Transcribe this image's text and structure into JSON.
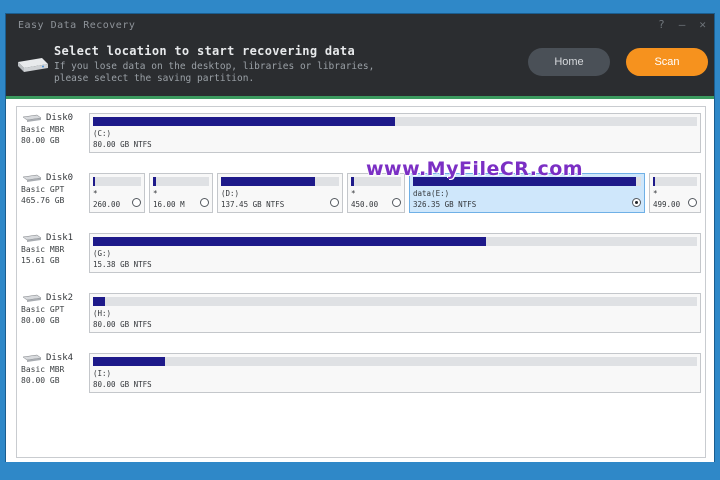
{
  "window": {
    "title": "Easy Data Recovery",
    "controls": [
      "?",
      "–",
      "✕"
    ]
  },
  "header": {
    "title": "Select location to start recovering data",
    "subtitle_line1": "If you lose data on the desktop, libraries or libraries,",
    "subtitle_line2": "please select the saving partition.",
    "home_button": "Home",
    "scan_button": "Scan",
    "icon": "hard-drive-icon"
  },
  "colors": {
    "accent_green": "#3c9a5f",
    "scan_orange": "#f6921e",
    "bar_fill": "#1e1a8a",
    "selected_bg": "#cfe7fb",
    "watermark": "#7b2fc4"
  },
  "watermark": "www.MyFileCR.com",
  "disks": [
    {
      "name": "Disk0",
      "type": "Basic MBR",
      "size": "80.00 GB",
      "partitions": [
        {
          "label": "(C:)",
          "size": "80.00 GB NTFS",
          "fill": 0.5,
          "radio": false,
          "selected": false
        }
      ]
    },
    {
      "name": "Disk0",
      "type": "Basic GPT",
      "size": "465.76 GB",
      "partitions": [
        {
          "label": "*",
          "size": "260.00",
          "fill": 0.05,
          "radio": true,
          "selected": false
        },
        {
          "label": "*",
          "size": "16.00 M",
          "fill": 0.05,
          "radio": true,
          "selected": false
        },
        {
          "label": "(D:)",
          "size": "137.45 GB NTFS",
          "fill": 0.8,
          "radio": true,
          "selected": false
        },
        {
          "label": "*",
          "size": "450.00",
          "fill": 0.05,
          "radio": true,
          "selected": false
        },
        {
          "label": "data(E:)",
          "size": "326.35 GB NTFS",
          "fill": 0.98,
          "radio": true,
          "selected": true
        },
        {
          "label": "*",
          "size": "499.00",
          "fill": 0.05,
          "radio": true,
          "selected": false
        }
      ]
    },
    {
      "name": "Disk1",
      "type": "Basic MBR",
      "size": "15.61 GB",
      "partitions": [
        {
          "label": "(G:)",
          "size": "15.38 GB NTFS",
          "fill": 0.65,
          "radio": false,
          "selected": false
        }
      ]
    },
    {
      "name": "Disk2",
      "type": "Basic GPT",
      "size": "80.00 GB",
      "partitions": [
        {
          "label": "(H:)",
          "size": "80.00 GB NTFS",
          "fill": 0.02,
          "radio": false,
          "selected": false
        }
      ]
    },
    {
      "name": "Disk4",
      "type": "Basic MBR",
      "size": "80.00 GB",
      "partitions": [
        {
          "label": "(I:)",
          "size": "80.00 GB NTFS",
          "fill": 0.12,
          "radio": false,
          "selected": false
        }
      ]
    }
  ]
}
